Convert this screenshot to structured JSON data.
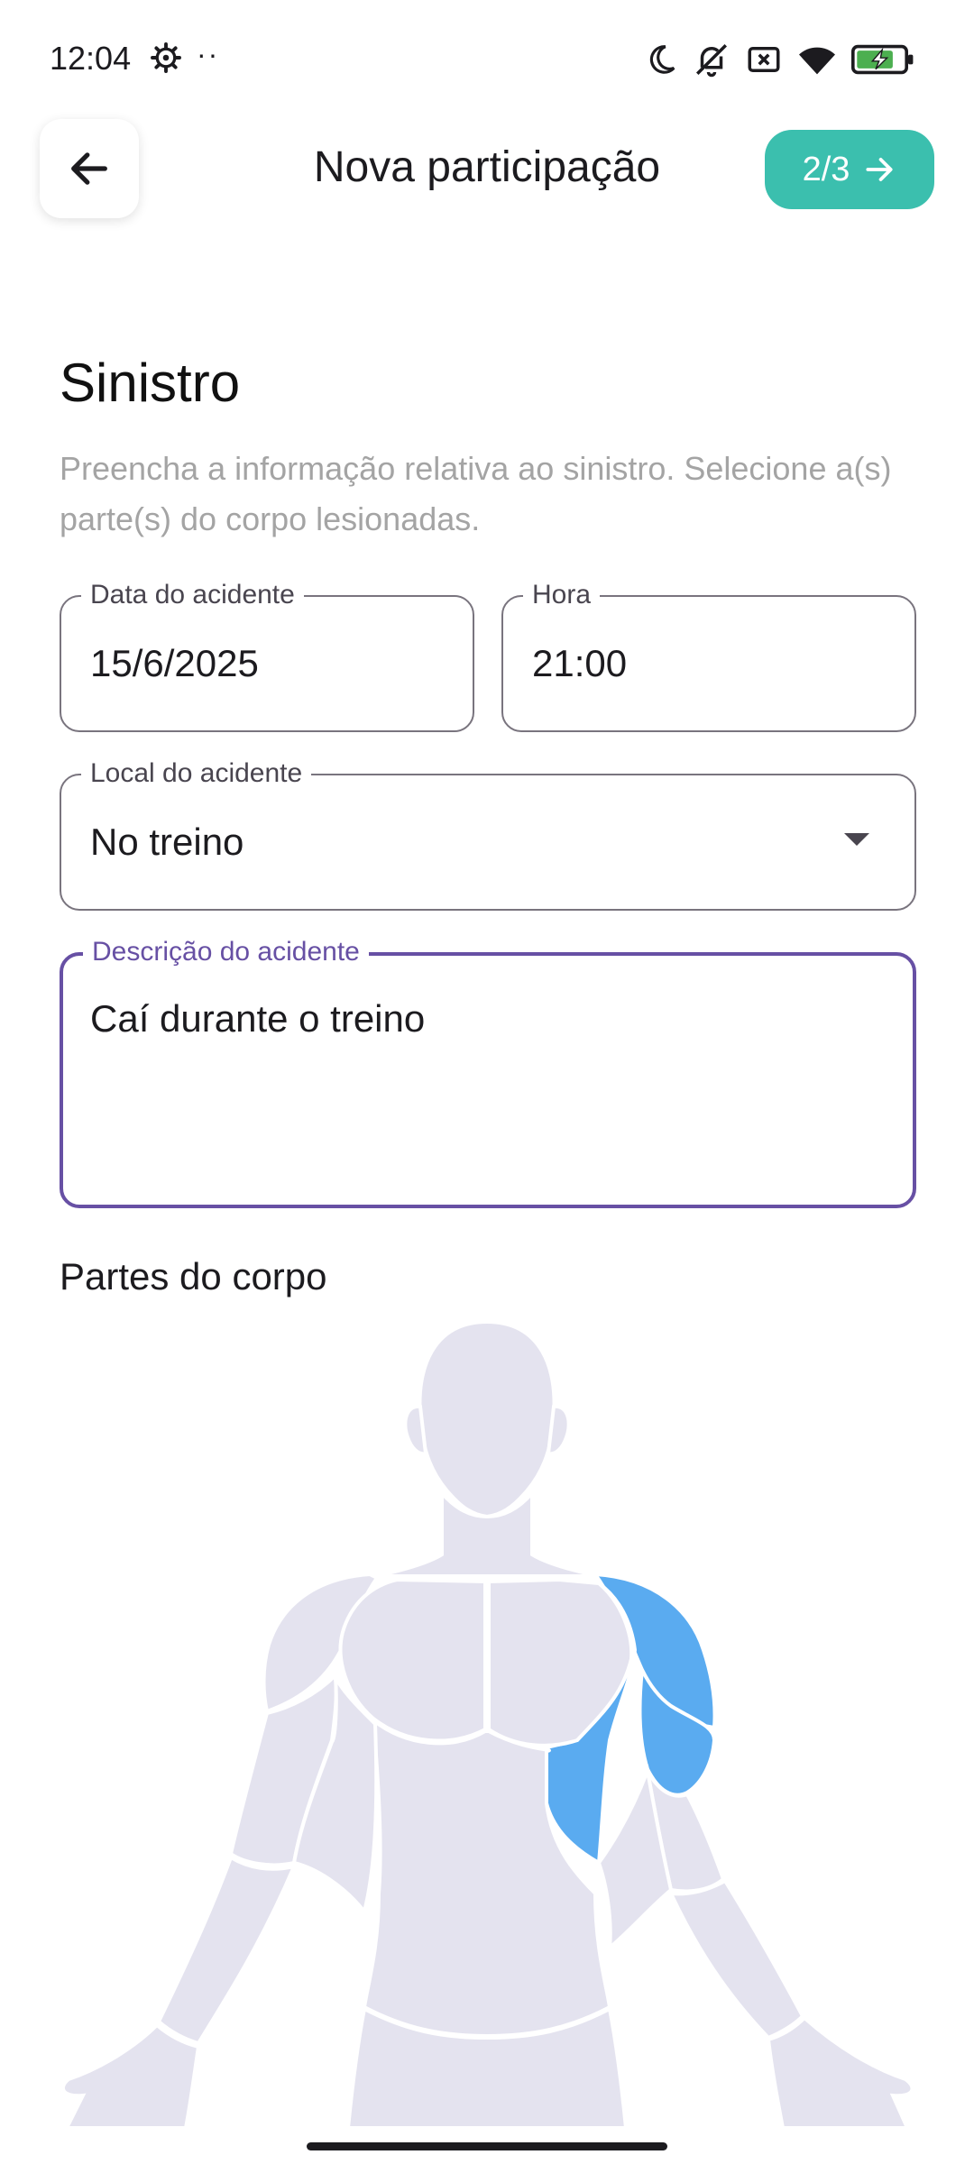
{
  "status_bar": {
    "time": "12:04",
    "dots": "··",
    "icons": [
      "gear-icon",
      "moon-icon",
      "bell-off-icon",
      "close-box-icon",
      "wifi-icon",
      "battery-charging-icon"
    ]
  },
  "app_bar": {
    "title": "Nova participação",
    "step_label": "2/3",
    "back_icon": "arrow-left-icon",
    "next_icon": "arrow-right-icon"
  },
  "section": {
    "title": "Sinistro",
    "description": "Preencha a informação relativa ao sinistro. Selecione a(s) parte(s) do corpo lesionadas."
  },
  "form": {
    "date": {
      "label": "Data do acidente",
      "value": "15/6/2025"
    },
    "time": {
      "label": "Hora",
      "value": "21:00"
    },
    "location": {
      "label": "Local do acidente",
      "value": "No treino"
    },
    "description": {
      "label": "Descrição do acidente",
      "value": "Caí durante o treino"
    }
  },
  "body_parts": {
    "title": "Partes do corpo",
    "selected": [
      "left-chest",
      "left-shoulder"
    ],
    "colors": {
      "unselected": "#e4e3ef",
      "selected": "#5aabf0"
    }
  },
  "colors": {
    "accent": "#3bbfae",
    "focus": "#6750a4"
  }
}
